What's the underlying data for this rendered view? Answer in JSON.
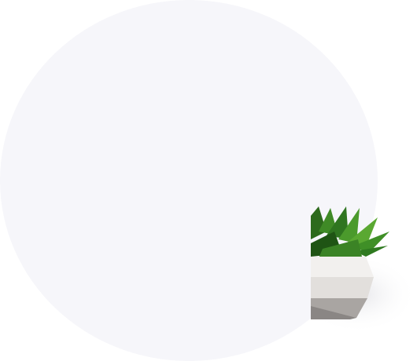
{
  "colors": {
    "background": "#ffffff",
    "circle": "#f6f6fa",
    "leaf_dark": "#2f6b1f",
    "leaf_light": "#5aa832",
    "pot_light": "#f2f0ee",
    "pot_dark": "#8a8684"
  },
  "illustration": {
    "subject": "succulent-in-pot-icon"
  }
}
